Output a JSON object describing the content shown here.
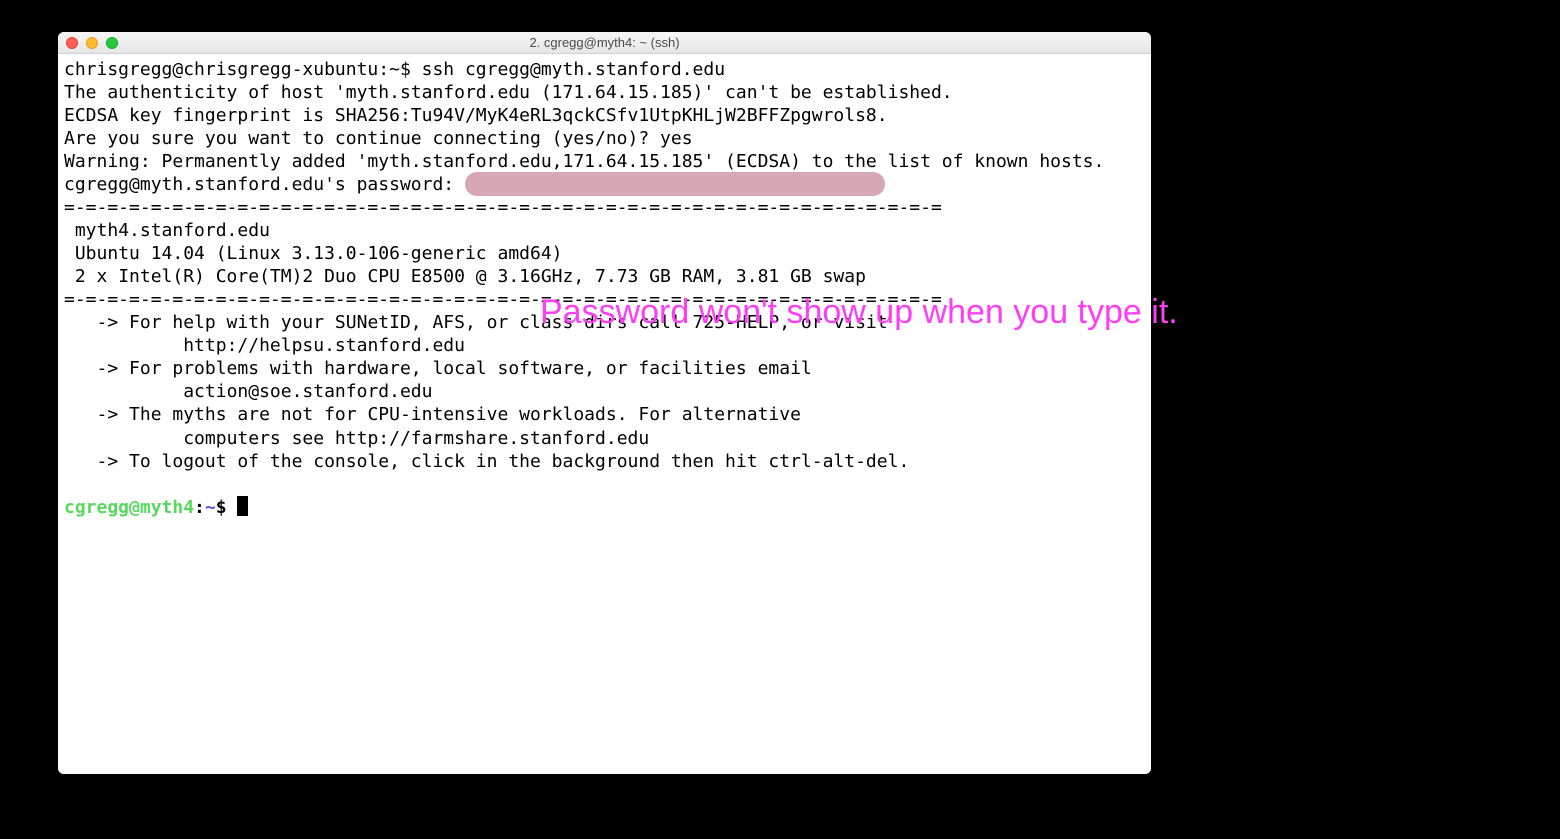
{
  "window": {
    "title": "2. cgregg@myth4: ~ (ssh)"
  },
  "terminal": {
    "line1": "chrisgregg@chrisgregg-xubuntu:~$ ssh cgregg@myth.stanford.edu",
    "line2": "The authenticity of host 'myth.stanford.edu (171.64.15.185)' can't be established.",
    "line3": "ECDSA key fingerprint is SHA256:Tu94V/MyK4eRL3qckCSfv1UtpKHLjW2BFFZpgwrols8.",
    "line4": "Are you sure you want to continue connecting (yes/no)? yes",
    "line5": "Warning: Permanently added 'myth.stanford.edu,171.64.15.185' (ECDSA) to the list of known hosts.",
    "line6a": "cgregg@myth.stanford.edu's password: ",
    "divider1": "=-=-=-=-=-=-=-=-=-=-=-=-=-=-=-=-=-=-=-=-=-=-=-=-=-=-=-=-=-=-=-=-=-=-=-=-=-=-=-=-=",
    "motd1": " myth4.stanford.edu",
    "motd2": " Ubuntu 14.04 (Linux 3.13.0-106-generic amd64)",
    "motd3": " 2 x Intel(R) Core(TM)2 Duo CPU E8500 @ 3.16GHz, 7.73 GB RAM, 3.81 GB swap",
    "divider2": "=-=-=-=-=-=-=-=-=-=-=-=-=-=-=-=-=-=-=-=-=-=-=-=-=-=-=-=-=-=-=-=-=-=-=-=-=-=-=-=-=",
    "help1": "   -> For help with your SUNetID, AFS, or class dirs call 725-HELP, or visit",
    "help1b": "           http://helpsu.stanford.edu",
    "help2": "   -> For problems with hardware, local software, or facilities email",
    "help2b": "           action@soe.stanford.edu",
    "help3": "   -> The myths are not for CPU-intensive workloads. For alternative",
    "help3b": "           computers see http://farmshare.stanford.edu",
    "help4": "   -> To logout of the console, click in the background then hit ctrl-alt-del.",
    "blank": "",
    "prompt_user": "cgregg@myth4",
    "prompt_colon": ":",
    "prompt_tilde": "~",
    "prompt_dollar": "$ "
  },
  "annotation": {
    "text": "Password won't show up when you type it."
  }
}
